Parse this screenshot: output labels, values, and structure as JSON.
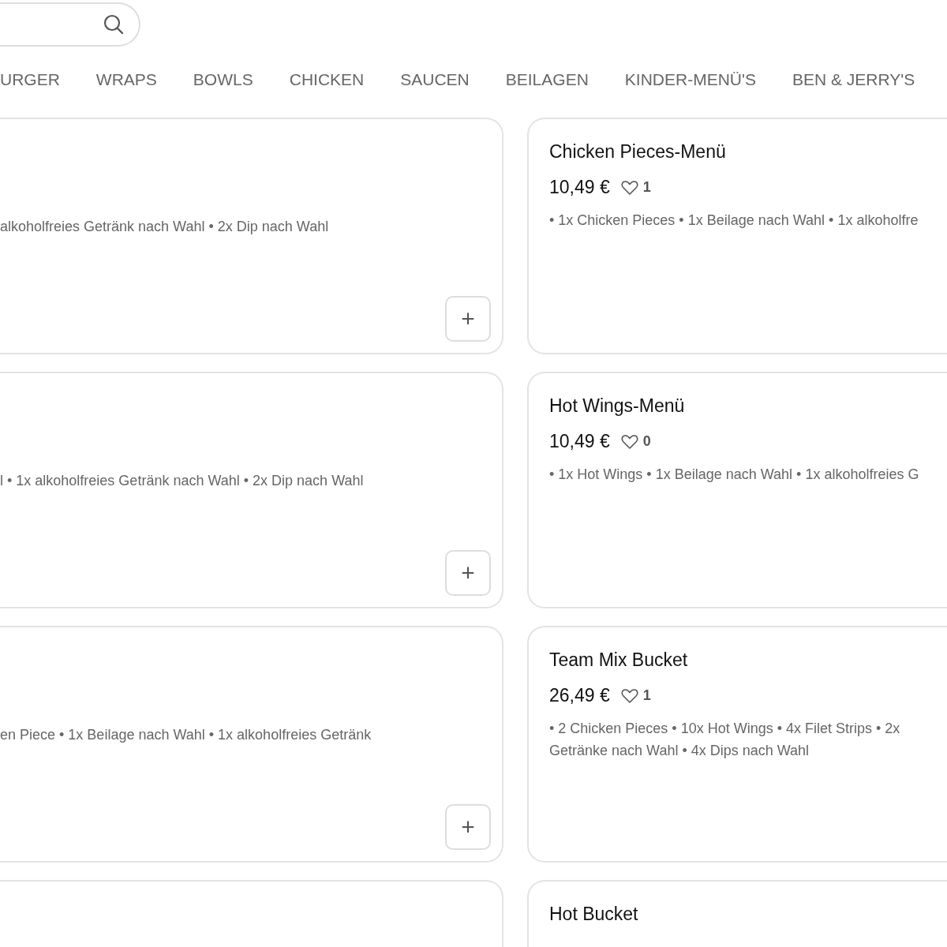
{
  "tabs": [
    {
      "label": "URGER"
    },
    {
      "label": "WRAPS"
    },
    {
      "label": "BOWLS"
    },
    {
      "label": "CHICKEN"
    },
    {
      "label": "SAUCEN"
    },
    {
      "label": "BEILAGEN"
    },
    {
      "label": "KINDER-MENÜ'S"
    },
    {
      "label": "BEN & JERRY'S"
    }
  ],
  "rows": [
    {
      "left": {
        "description": [
          "alkoholfreies Getränk nach Wahl • 2x Dip nach Wahl"
        ],
        "add_button": "+"
      },
      "right": {
        "title": "Chicken Pieces-Menü",
        "price": "10,49 €",
        "likes": "1",
        "description": [
          "• 1x Chicken Pieces • 1x Beilage nach Wahl • 1x alkoholfre"
        ]
      }
    },
    {
      "left": {
        "description": [
          "l • 1x alkoholfreies Getränk nach Wahl • 2x Dip nach Wahl"
        ],
        "add_button": "+"
      },
      "right": {
        "title": "Hot Wings-Menü",
        "price": "10,49 €",
        "likes": "0",
        "description": [
          "• 1x Hot Wings • 1x Beilage nach Wahl • 1x alkoholfreies G"
        ]
      }
    },
    {
      "left": {
        "description": [
          "en Piece • 1x Beilage nach Wahl • 1x alkoholfreies Getränk"
        ],
        "add_button": "+"
      },
      "right": {
        "title": "Team Mix Bucket",
        "price": "26,49 €",
        "likes": "1",
        "description": [
          "• 2 Chicken Pieces • 10x Hot Wings • 4x Filet Strips • 2x",
          "Getränke nach Wahl • 4x Dips nach Wahl"
        ]
      }
    },
    {
      "right": {
        "title": "Hot Bucket"
      }
    }
  ]
}
